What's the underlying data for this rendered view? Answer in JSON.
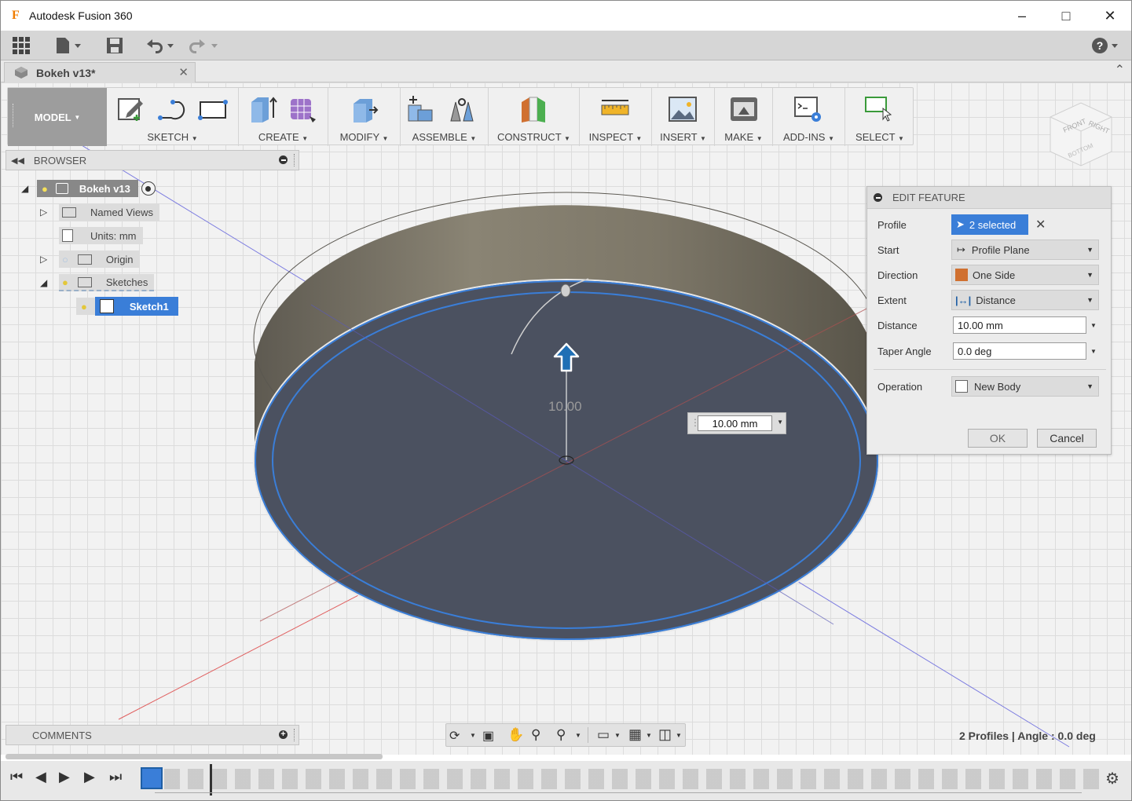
{
  "window": {
    "title": "Autodesk Fusion 360",
    "app_icon": "F"
  },
  "document_tab": {
    "title": "Bokeh v13*"
  },
  "toolbar": {
    "workspace": "MODEL",
    "groups": [
      {
        "label": "SKETCH"
      },
      {
        "label": "CREATE"
      },
      {
        "label": "MODIFY"
      },
      {
        "label": "ASSEMBLE"
      },
      {
        "label": "CONSTRUCT"
      },
      {
        "label": "INSPECT"
      },
      {
        "label": "INSERT"
      },
      {
        "label": "MAKE"
      },
      {
        "label": "ADD-INS"
      },
      {
        "label": "SELECT"
      }
    ]
  },
  "browser": {
    "header": "BROWSER",
    "items": [
      {
        "label": "Bokeh v13"
      },
      {
        "label": "Named Views"
      },
      {
        "label": "Units: mm"
      },
      {
        "label": "Origin"
      },
      {
        "label": "Sketches"
      },
      {
        "label": "Sketch1"
      }
    ]
  },
  "viewcube": {
    "front": "FRONT",
    "right": "RIGHT",
    "bottom": "BOTTOM"
  },
  "viewport": {
    "dimension_label": "10.00",
    "distance_input": "10.00 mm"
  },
  "edit_feature": {
    "header": "EDIT FEATURE",
    "rows": {
      "profile": {
        "label": "Profile",
        "value": "2 selected"
      },
      "start": {
        "label": "Start",
        "value": "Profile Plane"
      },
      "direction": {
        "label": "Direction",
        "value": "One Side"
      },
      "extent": {
        "label": "Extent",
        "value": "Distance"
      },
      "distance": {
        "label": "Distance",
        "value": "10.00 mm"
      },
      "taper": {
        "label": "Taper Angle",
        "value": "0.0 deg"
      },
      "operation": {
        "label": "Operation",
        "value": "New Body"
      }
    },
    "ok": "OK",
    "cancel": "Cancel"
  },
  "comments": {
    "header": "COMMENTS"
  },
  "status_text": "2 Profiles | Angle : 0.0 deg",
  "colors": {
    "accent": "#3a7ed8",
    "profile_face": "#4b5160",
    "wall": "#7a7466"
  }
}
